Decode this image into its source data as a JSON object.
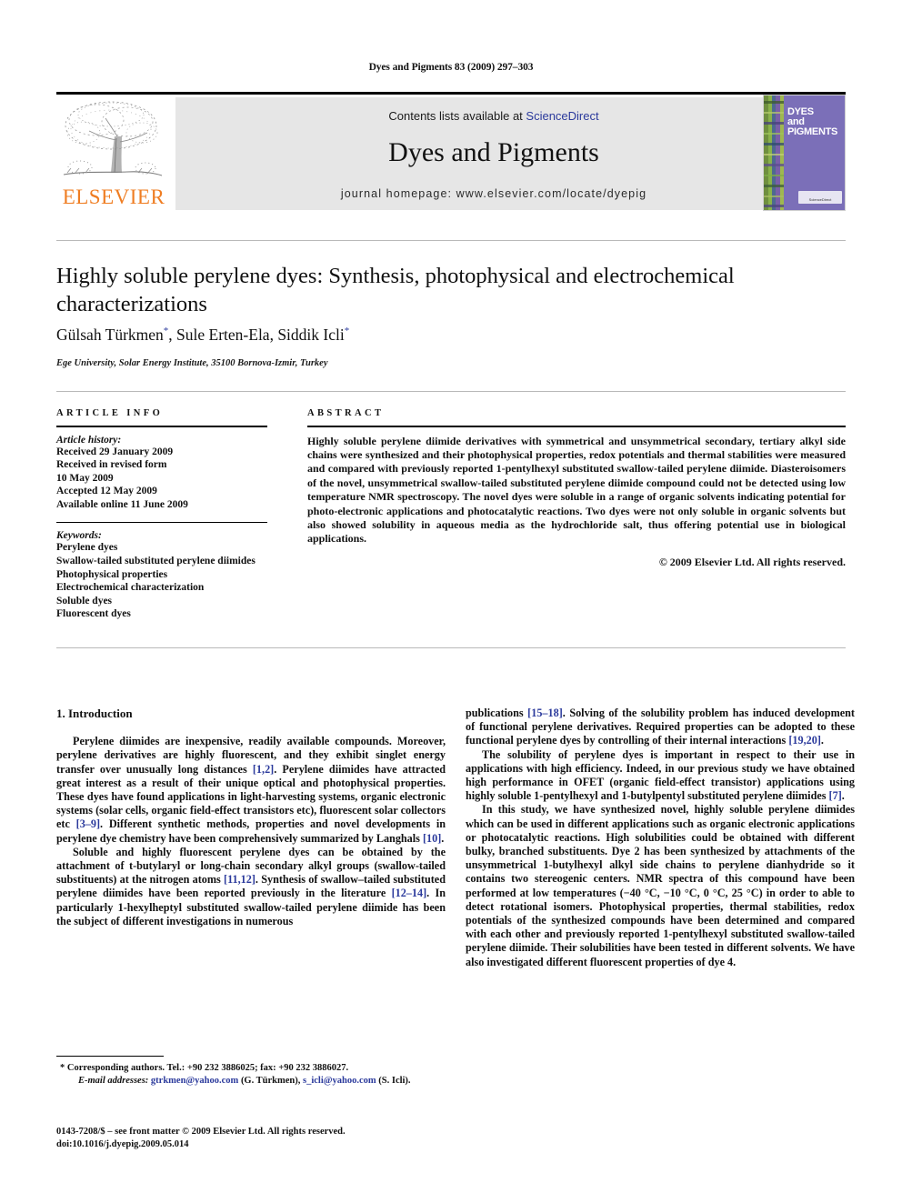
{
  "running_head": "Dyes and Pigments 83 (2009) 297–303",
  "masthead": {
    "publisher_name": "ELSEVIER",
    "contents_prefix": "Contents lists available at ",
    "contents_link": "ScienceDirect",
    "journal_title": "Dyes and Pigments",
    "homepage": "journal homepage: www.elsevier.com/locate/dyepig",
    "cover": {
      "line1": "DYES",
      "line2": "and",
      "line3": "PIGMENTS",
      "badge": "ScienceDirect",
      "bg_color": "#7b6fb8"
    }
  },
  "title": "Highly soluble perylene dyes: Synthesis, photophysical and electrochemical characterizations",
  "authors": "Gülsah Türkmen*, Sule Erten-Ela, Siddik Icli*",
  "affiliation": "Ege University, Solar Energy Institute, 35100 Bornova-Izmir, Turkey",
  "article_info": {
    "heading": "ARTICLE INFO",
    "history_label": "Article history:",
    "history": [
      "Received 29 January 2009",
      "Received in revised form",
      "10 May 2009",
      "Accepted 12 May 2009",
      "Available online 11 June 2009"
    ],
    "keywords_label": "Keywords:",
    "keywords": [
      "Perylene dyes",
      "Swallow-tailed substituted perylene diimides",
      "Photophysical properties",
      "Electrochemical characterization",
      "Soluble dyes",
      "Fluorescent dyes"
    ]
  },
  "abstract": {
    "heading": "ABSTRACT",
    "text": "Highly soluble perylene diimide derivatives with symmetrical and unsymmetrical secondary, tertiary alkyl side chains were synthesized and their photophysical properties, redox potentials and thermal stabilities were measured and compared with previously reported 1-pentylhexyl substituted swallow-tailed perylene diimide. Diasteroisomers of the novel, unsymmetrical swallow-tailed substituted perylene diimide compound could not be detected using low temperature NMR spectroscopy. The novel dyes were soluble in a range of organic solvents indicating potential for photo-electronic applications and photocatalytic reactions. Two dyes were not only soluble in organic solvents but also showed solubility in aqueous media as the hydrochloride salt, thus offering potential use in biological applications.",
    "copyright": "© 2009 Elsevier Ltd. All rights reserved."
  },
  "body": {
    "section_number_title": "1. Introduction",
    "left_paragraphs": [
      "Perylene diimides are inexpensive, readily available compounds. Moreover, perylene derivatives are highly fluorescent, and they exhibit singlet energy transfer over unusually long distances [1,2]. Perylene diimides have attracted great interest as a result of their unique optical and photophysical properties. These dyes have found applications in light-harvesting systems, organic electronic systems (solar cells, organic field-effect transistors etc), fluorescent solar collectors etc [3–9]. Different synthetic methods, properties and novel developments in perylene dye chemistry have been comprehensively summarized by Langhals [10].",
      "Soluble and highly fluorescent perylene dyes can be obtained by the attachment of t-butylaryl or long-chain secondary alkyl groups (swallow-tailed substituents) at the nitrogen atoms [11,12]. Synthesis of swallow–tailed substituted perylene diimides have been reported previously in the literature [12–14]. In particularly 1-hexylheptyl substituted swallow-tailed perylene diimide has been the subject of different investigations in numerous"
    ],
    "right_paragraphs": [
      "publications [15–18]. Solving of the solubility problem has induced development of functional perylene derivatives. Required properties can be adopted to these functional perylene dyes by controlling of their internal interactions [19,20].",
      "The solubility of perylene dyes is important in respect to their use in applications with high efficiency. Indeed, in our previous study we have obtained high performance in OFET (organic field-effect transistor) applications using highly soluble 1-pentylhexyl and 1-butylpentyl substituted perylene diimides [7].",
      "In this study, we have synthesized novel, highly soluble perylene diimides which can be used in different applications such as organic electronic applications or photocatalytic reactions. High solubilities could be obtained with different bulky, branched substituents. Dye 2 has been synthesized by attachments of the unsymmetrical 1-butylhexyl alkyl side chains to perylene dianhydride so it contains two stereogenic centers. NMR spectra of this compound have been performed at low temperatures (−40 °C, −10 °C, 0 °C, 25 °C) in order to able to detect rotational isomers. Photophysical properties, thermal stabilities, redox potentials of the synthesized compounds have been determined and compared with each other and previously reported 1-pentylhexyl substituted swallow-tailed perylene diimide. Their solubilities have been tested in different solvents. We have also investigated different fluorescent properties of dye 4."
    ]
  },
  "footnotes": {
    "corresponding": "* Corresponding authors. Tel.: +90 232 3886025; fax: +90 232 3886027.",
    "email_label": "E-mail addresses:",
    "email_1": "gtrkmen@yahoo.com",
    "email_1_owner": "(G. Türkmen),",
    "email_2": "s_icli@yahoo.com",
    "email_2_owner": "(S. Icli).",
    "issn_line": "0143-7208/$ – see front matter © 2009 Elsevier Ltd. All rights reserved.",
    "doi_line": "doi:10.1016/j.dyepig.2009.05.014"
  },
  "colors": {
    "link_blue": "#2b3a9c",
    "elsevier_orange": "#ef7d22",
    "band_gray": "#e6e6e6"
  }
}
